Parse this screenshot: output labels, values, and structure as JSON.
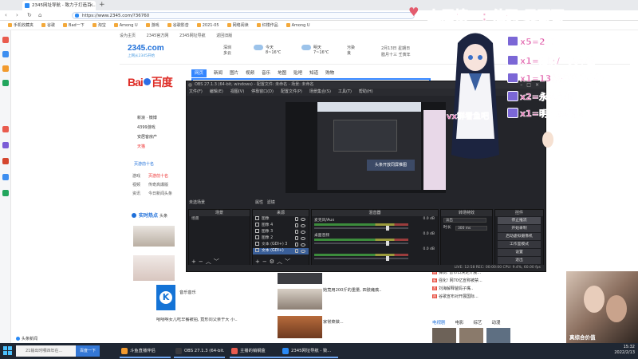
{
  "browser": {
    "tab_title": "2345网址导航 - 致力于打造百...",
    "tab_close": "×",
    "new_tab": "+",
    "nav": {
      "back": "‹",
      "forward": "›",
      "reload": "↻",
      "home": "⌂"
    },
    "url": "https://www.2345.com/?36760",
    "bookmarks": [
      "手机收藏夹",
      "谷歌",
      "Bad一下",
      "淘宝",
      "Among U",
      "游戏",
      "谷歌影音",
      "2021-05",
      "网络阅读",
      "红楼作品",
      "Among U"
    ],
    "status_text": "头条新闻"
  },
  "page": {
    "top_links": [
      "设为主页",
      "2345官方网",
      "2345网址导航",
      "返回旧版"
    ],
    "logo_main": "2345.com",
    "logo_sub": "上网从2345开始",
    "weather": [
      {
        "city": "深圳",
        "day": "今天",
        "desc": "多云",
        "temp": "8~16℃"
      },
      {
        "city": "",
        "day": "明天",
        "desc": "多云",
        "temp": "7~16℃"
      },
      {
        "city": "",
        "day": "",
        "desc": "污染",
        "temp": "良"
      }
    ],
    "date_line_1": "2月13日 星期日",
    "date_line_2": "腊月十三 壬寅年",
    "baidu_logo_left": "Bai",
    "baidu_logo_right": "百度",
    "search_tabs": [
      "网页",
      "新闻",
      "图片",
      "视频",
      "音乐",
      "地图",
      "贴吧",
      "知道",
      "购物"
    ],
    "search_active": "网页",
    "left_links": [
      "新浪 · 微博",
      "4399游戏",
      "安居客房产",
      "天猫"
    ],
    "site_section": "页游前十名",
    "categories": [
      [
        "游戏",
        "页游前十名"
      ],
      [
        "视频",
        "传奇高爆版"
      ],
      [
        "资讯",
        "今日新闻头条"
      ]
    ],
    "hot_title": "实时热点",
    "hot_tab2": "头条",
    "news_captions": [
      "音乐音乐",
      "视频",
      "她竟用200斤的重量, 四肢瘫痪..",
      "",
      "嘻嘻啊女儿吃早餐被拍, 竟形同父亲于大 小..",
      "家常菜做..."
    ],
    "news_right": [
      {
        "badge": "热",
        "text": "弹剑: 曾市日决定开展..."
      },
      {
        "badge": "新",
        "text": "强化! 网70亿宣称被禁..."
      },
      {
        "badge": "荐",
        "text": "刘海解释爸妈子嘴.."
      },
      {
        "badge": "热",
        "text": "谷歌宣布对开展国际..."
      }
    ],
    "right_tabs": [
      "电视剧",
      "电影",
      "综艺",
      "动漫"
    ],
    "right_tab_active": "电视剧"
  },
  "obs": {
    "title": "OBS 27.1.3 (64-bit, windows) - 配置文件: 未命名 - 场景: 未命名",
    "menu": [
      "文件(F)",
      "编辑(E)",
      "视图(V)",
      "停靠窗口(D)",
      "配置文件(P)",
      "场景集合(S)",
      "工具(T)",
      "帮助(H)"
    ],
    "preview_caption": "头条开放同屏推图",
    "scene_header": "未选场景",
    "scene_buttons": [
      "属性",
      "滤镜"
    ],
    "docks": {
      "scenes": {
        "title": "场景",
        "items": [
          "场景"
        ]
      },
      "sources": {
        "title": "来源",
        "items": [
          "图像",
          "图像 4",
          "图像 3",
          "图像 2",
          "文本 (GDI+) 3",
          "文本 (GDI+)"
        ],
        "selected": 5
      },
      "mixer": {
        "title": "混音器",
        "channels": [
          {
            "name": "麦克风/Aux",
            "db": "0.0 dB"
          },
          {
            "name": "桌面音频",
            "db": "0.0 dB"
          },
          {
            "name": "",
            "db": "0.0 dB"
          }
        ]
      },
      "transitions": {
        "title": "转场特效",
        "mode": "淡出",
        "duration_label": "时长",
        "duration": "300 ms"
      },
      "controls": {
        "title": "控件",
        "buttons": [
          "停止推流",
          "开始录制",
          "启动虚拟摄像机",
          "工作室模式",
          "设置",
          "退出"
        ]
      }
    },
    "status": "LIVE: 12:58  REC: 00:00:00  CPU: 9.4%, 60.00 fps"
  },
  "overlay": {
    "title": "上周榜一: 他码 吴哥哥",
    "heart": "♥",
    "bonuses": [
      "x5=2局",
      "x1=插队/一天车位",
      "x1=13级粉丝牌房管",
      "x2=永久车位",
      "x1=明星の心愿"
    ],
    "fish_text": "vx群看鱼吧",
    "webcam_caption": "真综合价值"
  },
  "taskbar": {
    "search_placeholder": "21输出时哪四年在...",
    "search_button": "百度一下",
    "items": [
      "斗鱼直播伴侣",
      "OBS 27.1.3 (64-bit...",
      "主播的销钢盒",
      "2345网址导航 - 致..."
    ],
    "time": "15:32",
    "date": "2022/2/13"
  },
  "colors": {
    "accent": "#3385ff",
    "brand_2345": "#1e6fd9",
    "baidu_red": "#de2c26",
    "obs_bg": "#24252a",
    "overlay_pink": "#e05aa8"
  }
}
